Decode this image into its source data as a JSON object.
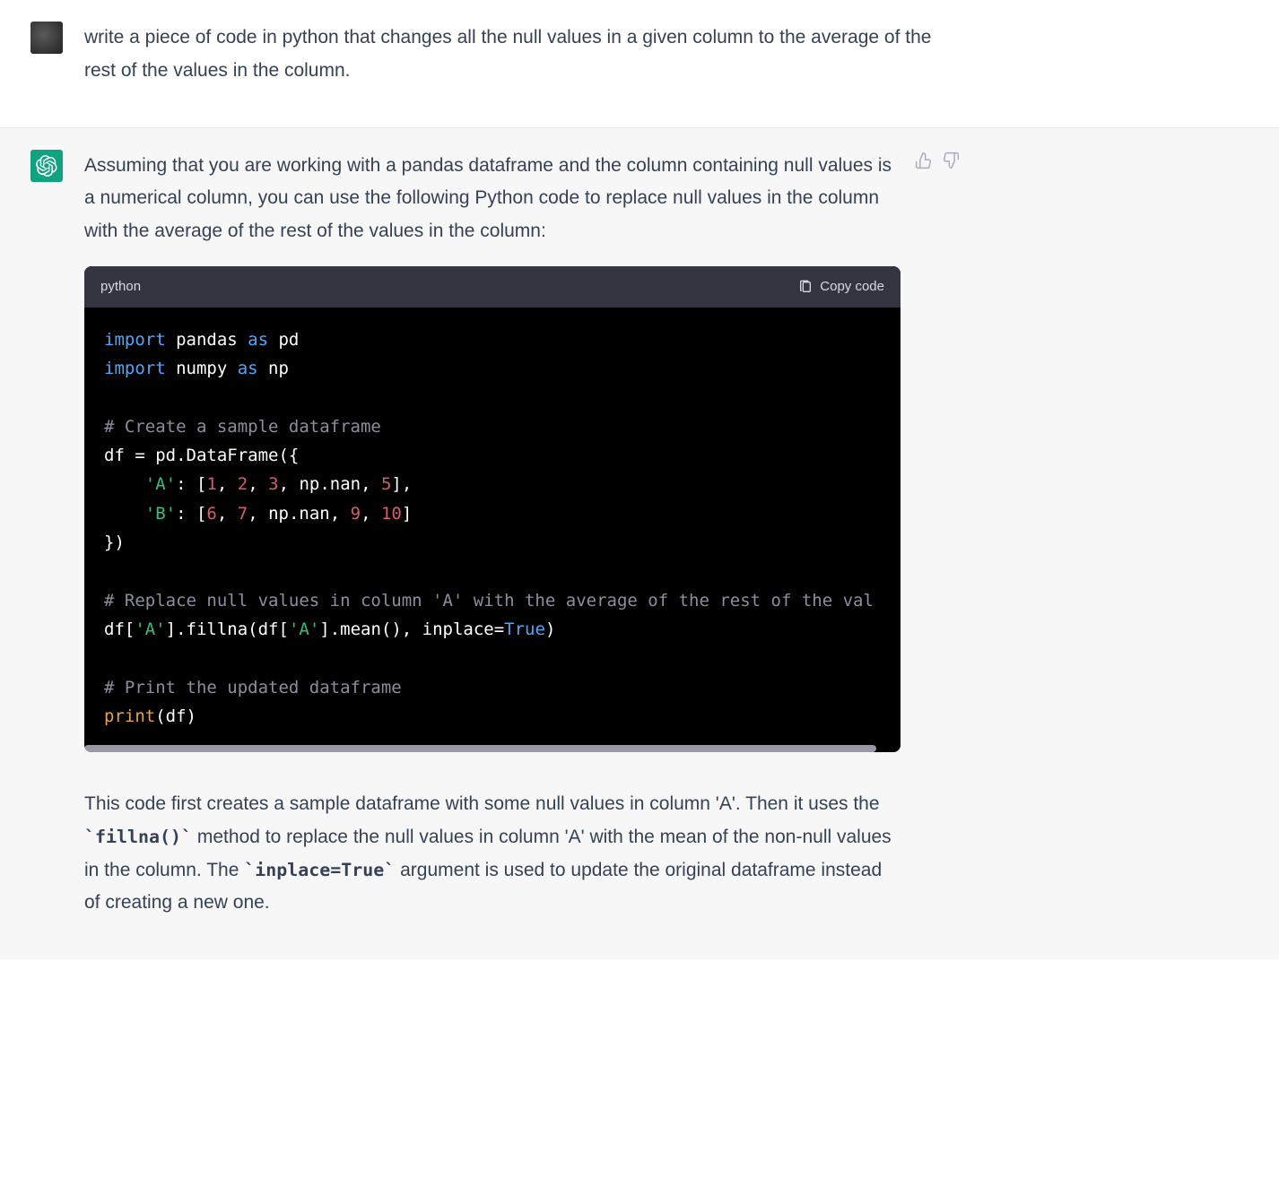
{
  "user_message": {
    "text": "write a piece of code in python that changes all the null values in a given column to the average of the rest of the values in the column."
  },
  "assistant_message": {
    "intro": "Assuming that you are working with a pandas dataframe and the column containing null values is a numerical column, you can use the following Python code to replace null values in the column with the average of the rest of the values in the column:",
    "code_lang": "python",
    "copy_label": "Copy code",
    "code_tokens": [
      [
        {
          "c": "tok-kw",
          "t": "import"
        },
        {
          "c": "",
          "t": " pandas "
        },
        {
          "c": "tok-kw",
          "t": "as"
        },
        {
          "c": "",
          "t": " pd"
        }
      ],
      [
        {
          "c": "tok-kw",
          "t": "import"
        },
        {
          "c": "",
          "t": " numpy "
        },
        {
          "c": "tok-kw",
          "t": "as"
        },
        {
          "c": "",
          "t": " np"
        }
      ],
      [],
      [
        {
          "c": "tok-cmt",
          "t": "# Create a sample dataframe"
        }
      ],
      [
        {
          "c": "",
          "t": "df = pd.DataFrame({"
        }
      ],
      [
        {
          "c": "",
          "t": "    "
        },
        {
          "c": "tok-str",
          "t": "'A'"
        },
        {
          "c": "",
          "t": ": ["
        },
        {
          "c": "tok-num",
          "t": "1"
        },
        {
          "c": "",
          "t": ", "
        },
        {
          "c": "tok-num",
          "t": "2"
        },
        {
          "c": "",
          "t": ", "
        },
        {
          "c": "tok-num",
          "t": "3"
        },
        {
          "c": "",
          "t": ", np.nan, "
        },
        {
          "c": "tok-num",
          "t": "5"
        },
        {
          "c": "",
          "t": "],"
        }
      ],
      [
        {
          "c": "",
          "t": "    "
        },
        {
          "c": "tok-str",
          "t": "'B'"
        },
        {
          "c": "",
          "t": ": ["
        },
        {
          "c": "tok-num",
          "t": "6"
        },
        {
          "c": "",
          "t": ", "
        },
        {
          "c": "tok-num",
          "t": "7"
        },
        {
          "c": "",
          "t": ", np.nan, "
        },
        {
          "c": "tok-num",
          "t": "9"
        },
        {
          "c": "",
          "t": ", "
        },
        {
          "c": "tok-num",
          "t": "10"
        },
        {
          "c": "",
          "t": "]"
        }
      ],
      [
        {
          "c": "",
          "t": "})"
        }
      ],
      [],
      [
        {
          "c": "tok-cmt",
          "t": "# Replace null values in column 'A' with the average of the rest of the val"
        }
      ],
      [
        {
          "c": "",
          "t": "df["
        },
        {
          "c": "tok-str",
          "t": "'A'"
        },
        {
          "c": "",
          "t": "].fillna(df["
        },
        {
          "c": "tok-str",
          "t": "'A'"
        },
        {
          "c": "",
          "t": "].mean(), inplace="
        },
        {
          "c": "tok-bool",
          "t": "True"
        },
        {
          "c": "",
          "t": ")"
        }
      ],
      [],
      [
        {
          "c": "tok-cmt",
          "t": "# Print the updated dataframe"
        }
      ],
      [
        {
          "c": "tok-fn",
          "t": "print"
        },
        {
          "c": "",
          "t": "(df)"
        }
      ]
    ],
    "outro_parts": [
      {
        "type": "text",
        "t": "This code first creates a sample dataframe with some null values in column 'A'. Then it uses the "
      },
      {
        "type": "code",
        "t": "`fillna()`"
      },
      {
        "type": "text",
        "t": " method to replace the null values in column 'A' with the mean of the non-null values in the column. The "
      },
      {
        "type": "code",
        "t": "`inplace=True`"
      },
      {
        "type": "text",
        "t": " argument is used to update the original dataframe instead of creating a new one."
      }
    ]
  }
}
